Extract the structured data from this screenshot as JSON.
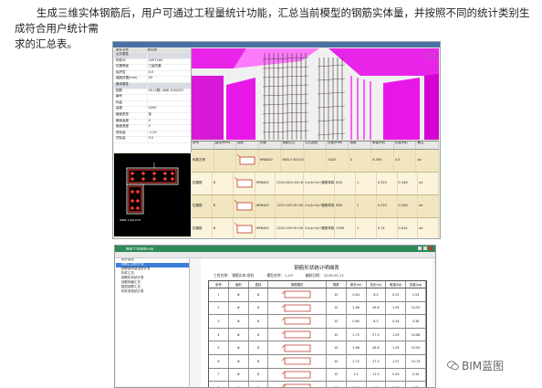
{
  "caption": {
    "line1": "生成三维实体钢筋后，用户可通过工程量统计功能，汇总当前模型的钢筋实体量，并按照不同的统计类别生成符合用户统计需",
    "line2": "求的汇总表。"
  },
  "screenshot1": {
    "props_header": [
      "属性名称",
      "属性值"
    ],
    "props": [
      {
        "k": "公共属性",
        "v": "",
        "section": true
      },
      {
        "k": "构件ID",
        "v": "1097180"
      },
      {
        "k": "抗震等级",
        "v": "三级抗震"
      },
      {
        "k": "保护层",
        "v": "0.0"
      },
      {
        "k": "锚固设置(mm)",
        "v": "20"
      },
      {
        "k": "基本属性",
        "v": "",
        "section": true
      },
      {
        "k": "配筋",
        "v": "20 (4根) 4Φ8-100/200"
      },
      {
        "k": "编号",
        "v": ""
      },
      {
        "k": "标高",
        "v": ""
      },
      {
        "k": "高度",
        "v": "4200"
      },
      {
        "k": "截面类型",
        "v": "矩"
      },
      {
        "k": "截面高度",
        "v": "0"
      },
      {
        "k": "截面宽度",
        "v": "0"
      },
      {
        "k": "底标高",
        "v": "-1.20"
      },
      {
        "k": "顶标高",
        "v": "3.0"
      }
    ],
    "section_label": "4Φ8-100/200",
    "table_header": [
      "序号",
      "直径(mm)",
      "图形",
      "长度",
      "简图公式",
      "公式描述",
      "长度(mm)",
      "根数",
      "单重(kg)",
      "总重(kg)",
      "备注"
    ],
    "table_rows": [
      [
        "纵筋左侧",
        "",
        "",
        "HRB400",
        "3601+40×20",
        "",
        "3420",
        "4",
        "6.090",
        "4.5",
        "ok"
      ],
      [
        "柱箍筋",
        "8",
        "",
        "HRB400",
        "250×200+40+8",
        "2×(b+h)+箍筋弯钩",
        "800",
        "1",
        "0.320",
        "0.346",
        "ok"
      ],
      [
        "柱箍筋",
        "8",
        "",
        "HRB400",
        "125+125+8+40",
        "2×(b+h)+箍筋弯钩",
        "680",
        "1",
        "0.320",
        "0.346",
        "ok"
      ],
      [
        "柱箍筋",
        "8",
        "",
        "HRB400",
        "125×125+8+40",
        "2×(b+h)+箍筋弯钩",
        "1950",
        "1",
        "0.74",
        "0.044",
        "ok"
      ]
    ]
  },
  "screenshot2": {
    "title": "钢筋工程量统计表",
    "tree": [
      "统计报表",
      "钢筋汇总统计表",
      "钢筋级别直径统计表",
      "构件汇总",
      "钢筋形状统计表",
      "钢筋明细汇总",
      "楼层钢筋汇总",
      "构件类型统计表"
    ],
    "selected_index": 1,
    "page_title": "钢筋形状统计明细表",
    "info": [
      "工程名称：  钢筋实体-框柱",
      "模型名称：  L-03",
      "编制日期：  2018-05-11"
    ],
    "header": [
      "序号",
      "级别",
      "直径",
      "钢筋图形",
      "根数",
      "单长(m)",
      "总长(m)",
      "单重(kg)",
      "总重(kg)"
    ],
    "rows": [
      [
        "1",
        "Φ",
        "8",
        "",
        "10",
        "0.64",
        "6.4",
        "0.25",
        "2.53"
      ],
      [
        "2",
        "Φ",
        "8",
        "",
        "10",
        "2.66",
        "26.6",
        "1.05",
        "10.50"
      ],
      [
        "3",
        "Φ",
        "8",
        "",
        "10",
        "0.85",
        "8.5",
        "0.34",
        "3.36"
      ],
      [
        "4",
        "Φ",
        "8",
        "",
        "10",
        "2.75",
        "27.5",
        "1.09",
        "10.86"
      ],
      [
        "5",
        "Φ",
        "8",
        "",
        "10",
        "2.66",
        "26.6",
        "1.05",
        "10.50"
      ],
      [
        "6",
        "Φ",
        "8",
        "",
        "10",
        "2.72",
        "27.2",
        "1.07",
        "10.74"
      ],
      [
        "7",
        "Φ",
        "8",
        "",
        "10",
        "1.1",
        "11.0",
        "0.43",
        "4.34"
      ],
      [
        "8",
        "Φ",
        "8",
        "",
        "10",
        "0.95",
        "9.5",
        "0.38",
        "3.75"
      ]
    ]
  },
  "watermark": "BIM蓝图",
  "colors": {
    "magenta": "#e600e6",
    "dark_rebar": "#3b2a2a",
    "row_odd": "#f2e6c1",
    "row_even": "#fbf3dc",
    "accent_green": "#2e8b57"
  }
}
